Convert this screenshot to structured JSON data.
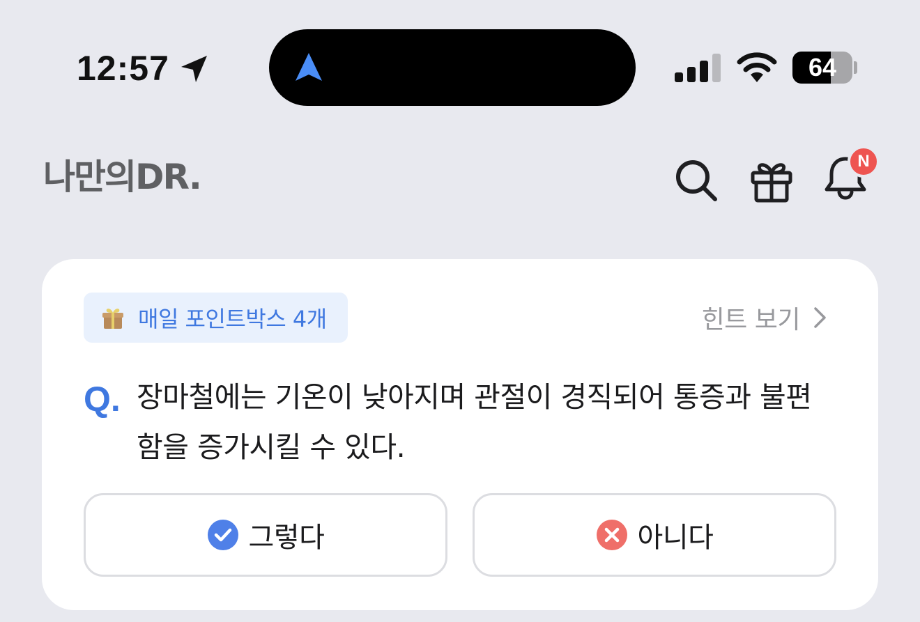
{
  "status_bar": {
    "time": "12:57",
    "battery_percent": 64,
    "battery_label": "64"
  },
  "header": {
    "logo_text": "나만의DR.",
    "notification_badge": "N"
  },
  "quiz": {
    "points_label": "매일 포인트박스 4개",
    "hint_label": "힌트 보기",
    "q_mark": "Q.",
    "question": "장마철에는 기온이 낮아지며 관절이 경직되어 통증과 불편함을 증가시킬 수 있다.",
    "answers": [
      {
        "label": "그렇다",
        "icon": "check-circle-icon",
        "color": "#4f80e8"
      },
      {
        "label": "아니다",
        "icon": "x-circle-icon",
        "color": "#ef6f69"
      }
    ]
  },
  "colors": {
    "accent": "#3f78e0",
    "background": "#e8e9ef",
    "badge": "#ee5450"
  }
}
